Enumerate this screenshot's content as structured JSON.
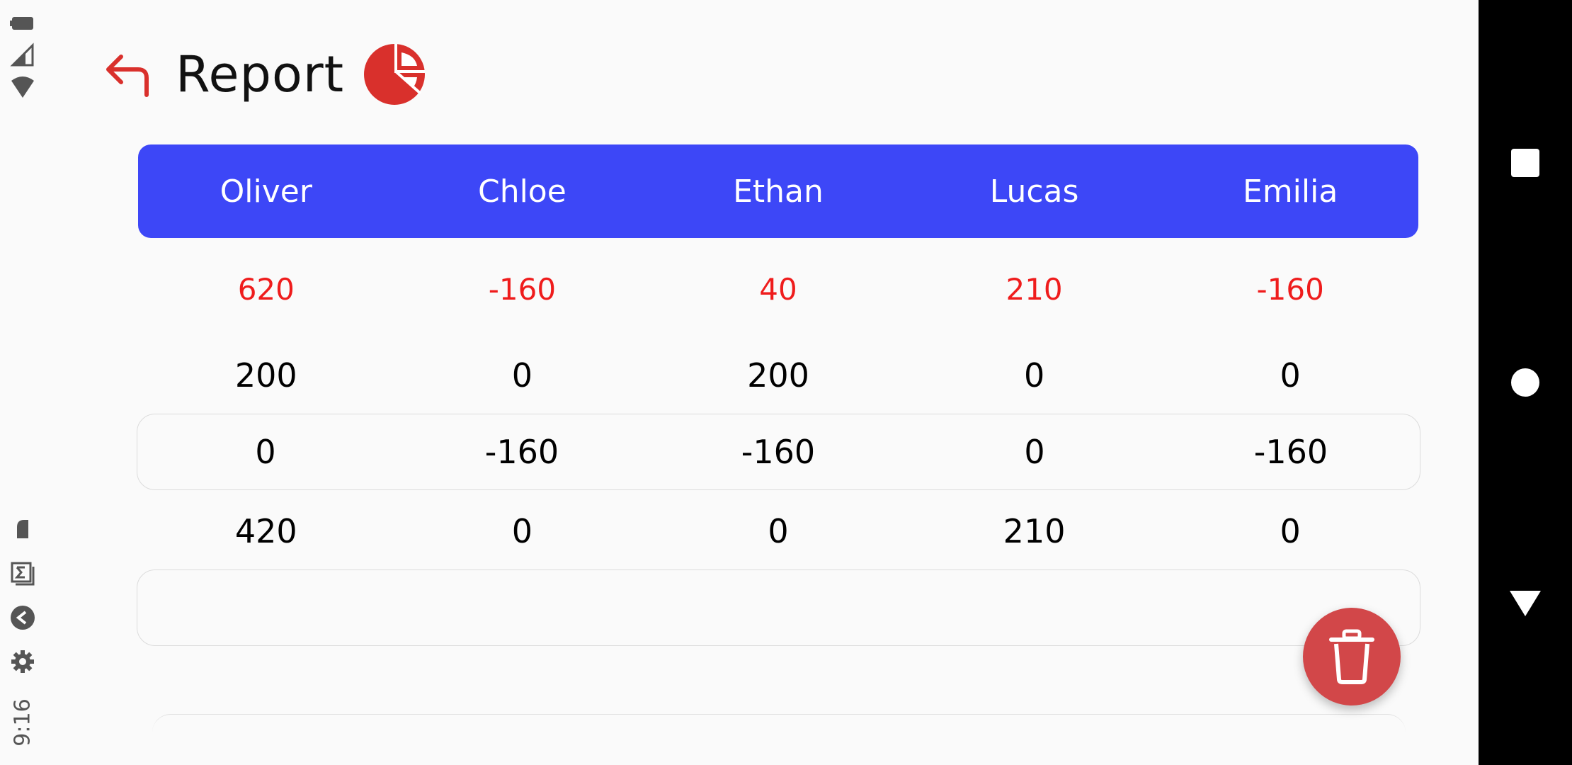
{
  "status_bar": {
    "time": "9:16",
    "icons": [
      "battery-icon",
      "signal-icon",
      "wifi-icon",
      "notification-icon",
      "sigma-app-icon",
      "chevron-app-icon",
      "settings-icon"
    ]
  },
  "header": {
    "back_icon": "back-arrow-icon",
    "title": "Report",
    "chart_icon": "pie-chart-icon"
  },
  "table": {
    "columns": [
      "Oliver",
      "Chloe",
      "Ethan",
      "Lucas",
      "Emilia"
    ],
    "totals": [
      "620",
      "-160",
      "40",
      "210",
      "-160"
    ],
    "rows": [
      [
        "200",
        "0",
        "200",
        "0",
        "0"
      ],
      [
        "0",
        "-160",
        "-160",
        "0",
        "-160"
      ],
      [
        "420",
        "0",
        "0",
        "210",
        "0"
      ]
    ]
  },
  "fab": {
    "icon": "trash-icon"
  },
  "nav_bar": {
    "buttons": [
      "recents-square-icon",
      "home-circle-icon",
      "back-triangle-icon"
    ]
  },
  "colors": {
    "header_bg": "#3d47f7",
    "total_text": "#ef1c1c",
    "accent_red": "#d9302c",
    "fab_bg": "#d24749"
  }
}
